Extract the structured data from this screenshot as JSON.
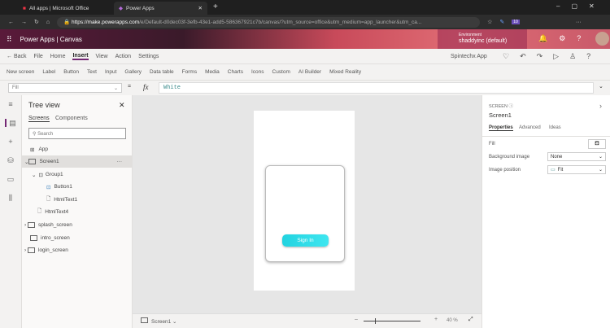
{
  "browser": {
    "tabs": [
      "All apps | Microsoft Office",
      "Power Apps"
    ],
    "url_host": "https://make.powerapps.com",
    "url_path": "/e/Default-d0dec03f-3efb-43e1-add5-586367921c7b/canvas/?utm_source=office&utm_medium=app_launcher&utm_ca...",
    "ext_badge": "10"
  },
  "header": {
    "title": "Power Apps | Canvas",
    "env_label": "Environment",
    "env_name": "shaddyinc (default)"
  },
  "menu": {
    "back": "Back",
    "items": [
      "File",
      "Home",
      "Insert",
      "View",
      "Action",
      "Settings"
    ],
    "active": "Insert",
    "app_name": "Spintechx App"
  },
  "toolbar": [
    "New screen",
    "Label",
    "Button",
    "Text",
    "Input",
    "Gallery",
    "Data table",
    "Forms",
    "Media",
    "Charts",
    "Icons",
    "Custom",
    "AI Builder",
    "Mixed Reality"
  ],
  "formula": {
    "property": "Fill",
    "fx": "fx",
    "value": "White"
  },
  "tree": {
    "title": "Tree view",
    "tabs": [
      "Screens",
      "Components"
    ],
    "search_placeholder": "Search",
    "items": [
      "App",
      "Screen1",
      "Group1",
      "Button1",
      "HtmlText1",
      "HtmlText4",
      "splash_screen",
      "intro_screen",
      "login_screen"
    ]
  },
  "canvas": {
    "button_label": "Sign In",
    "screen_select": "Screen1",
    "zoom": "40 %"
  },
  "props": {
    "type": "SCREEN",
    "name": "Screen1",
    "tabs": [
      "Properties",
      "Advanced",
      "Ideas"
    ],
    "fill_label": "Fill",
    "bg_label": "Background image",
    "bg_value": "None",
    "pos_label": "Image position",
    "pos_value": "Fit"
  }
}
